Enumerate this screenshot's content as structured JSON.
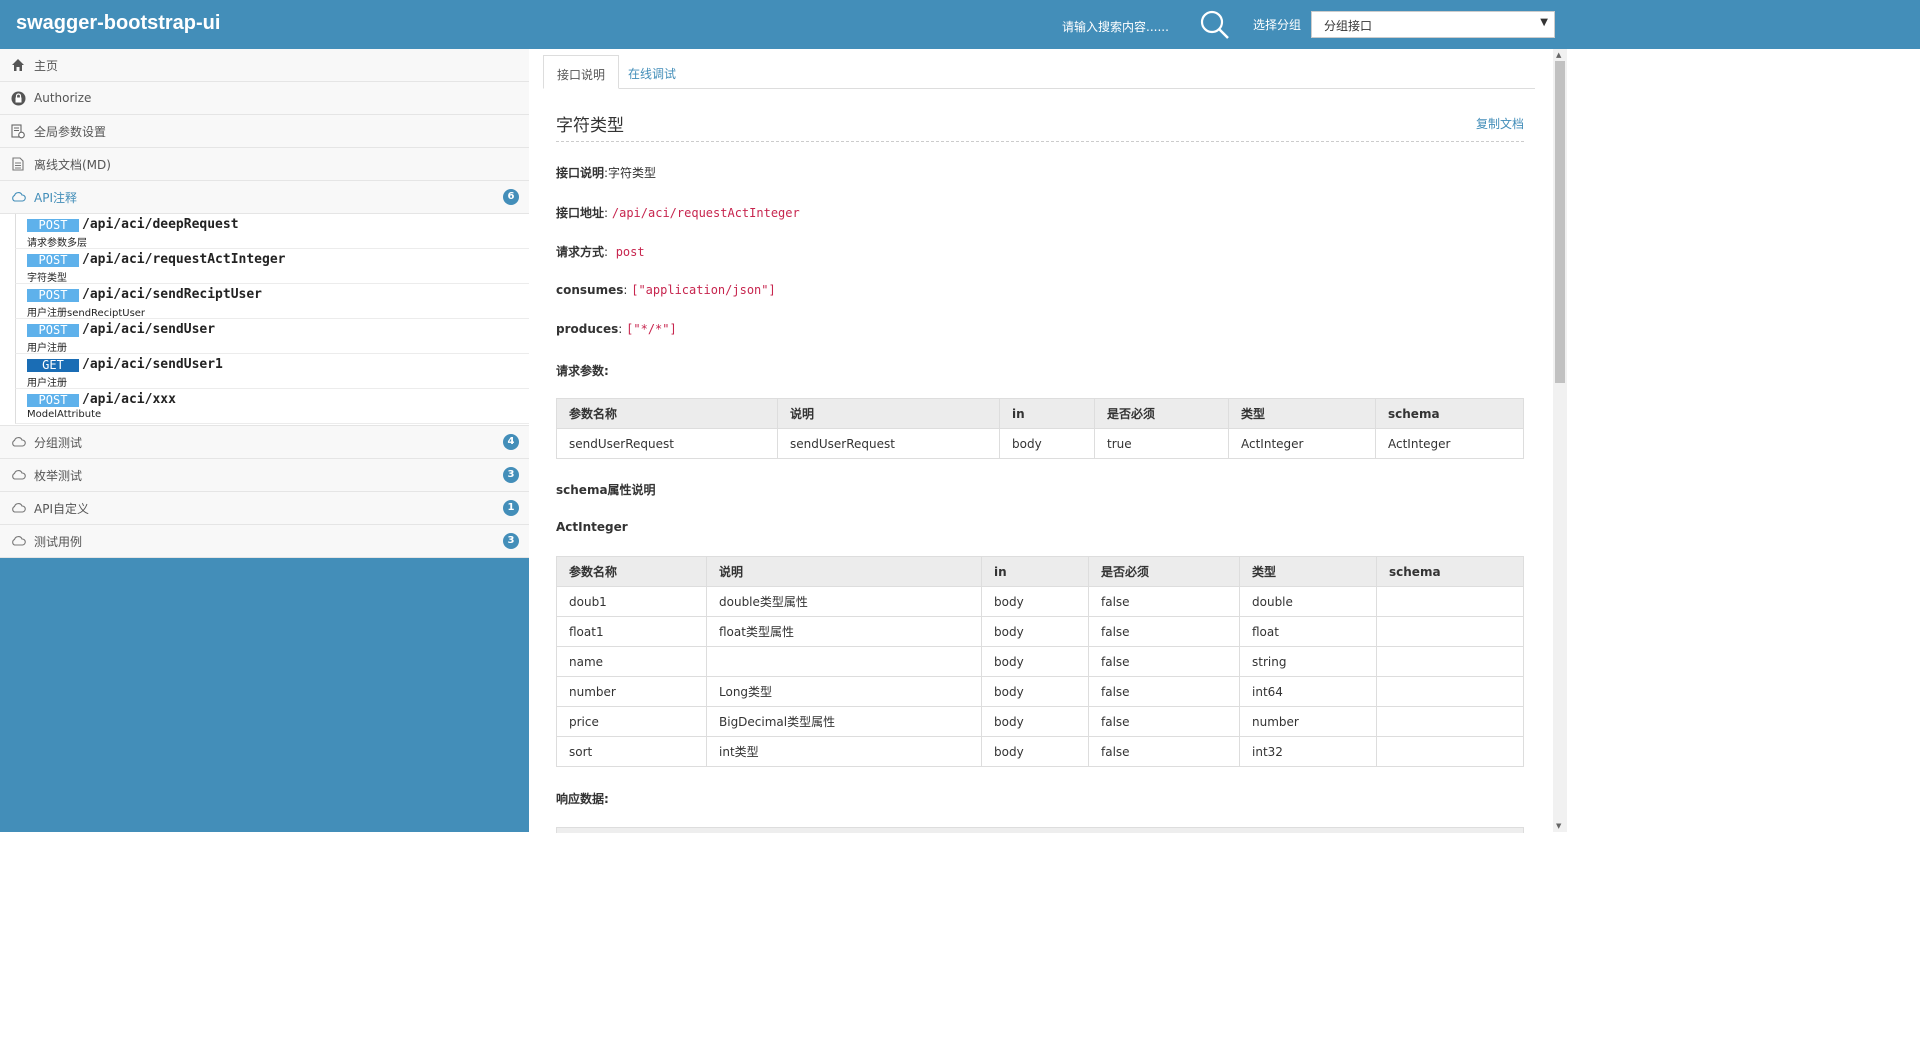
{
  "header": {
    "brand": "swagger-bootstrap-ui",
    "search_placeholder": "请输入搜索内容......",
    "group_label": "选择分组",
    "group_selected": "分组接口"
  },
  "sidebar": {
    "items": [
      {
        "label": "主页",
        "icon": "home-icon"
      },
      {
        "label": "Authorize",
        "icon": "lock-icon"
      },
      {
        "label": "全局参数设置",
        "icon": "settings-doc-icon"
      },
      {
        "label": "离线文档(MD)",
        "icon": "file-icon"
      }
    ],
    "groups": [
      {
        "label": "API注释",
        "count": "6",
        "expanded": true
      },
      {
        "label": "分组测试",
        "count": "4"
      },
      {
        "label": "枚举测试",
        "count": "3"
      },
      {
        "label": "API自定义",
        "count": "1"
      },
      {
        "label": "测试用例",
        "count": "3"
      }
    ],
    "apis": [
      {
        "method": "POST",
        "path": "/api/aci/deepRequest",
        "desc": "请求参数多层"
      },
      {
        "method": "POST",
        "path": "/api/aci/requestActInteger",
        "desc": "字符类型"
      },
      {
        "method": "POST",
        "path": "/api/aci/sendReciptUser",
        "desc": "用户注册sendReciptUser"
      },
      {
        "method": "POST",
        "path": "/api/aci/sendUser",
        "desc": "用户注册"
      },
      {
        "method": "GET",
        "path": "/api/aci/sendUser1",
        "desc": "用户注册"
      },
      {
        "method": "POST",
        "path": "/api/aci/xxx",
        "desc": "ModelAttribute"
      }
    ]
  },
  "tabs": {
    "doc": "接口说明",
    "debug": "在线调试"
  },
  "doc": {
    "title": "字符类型",
    "copy": "复制文档",
    "desc_label": "接口说明",
    "desc_value": ":字符类型",
    "url_label": "接口地址",
    "url_value": "/api/aci/requestActInteger",
    "method_label": "请求方式",
    "method_value": "post",
    "consumes_label": "consumes",
    "consumes_value": "[\"application/json\"]",
    "produces_label": "produces",
    "produces_value": "[\"*/*\"]",
    "params_label": "请求参数:",
    "schema_label": "schema属性说明",
    "schema_name": "ActInteger",
    "response_label": "响应数据:"
  },
  "params_table": {
    "headers": [
      "参数名称",
      "说明",
      "in",
      "是否必须",
      "类型",
      "schema"
    ],
    "rows": [
      [
        "sendUserRequest",
        "sendUserRequest",
        "body",
        "true",
        "ActInteger",
        "ActInteger"
      ]
    ]
  },
  "schema_table": {
    "headers": [
      "参数名称",
      "说明",
      "in",
      "是否必须",
      "类型",
      "schema"
    ],
    "rows": [
      [
        "doub1",
        "double类型属性",
        "body",
        "false",
        "double",
        ""
      ],
      [
        "float1",
        "float类型属性",
        "body",
        "false",
        "float",
        ""
      ],
      [
        "name",
        "",
        "body",
        "false",
        "string",
        ""
      ],
      [
        "number",
        "Long类型",
        "body",
        "false",
        "int64",
        ""
      ],
      [
        "price",
        "BigDecimal类型属性",
        "body",
        "false",
        "number",
        ""
      ],
      [
        "sort",
        "int类型",
        "body",
        "false",
        "int32",
        ""
      ]
    ]
  }
}
